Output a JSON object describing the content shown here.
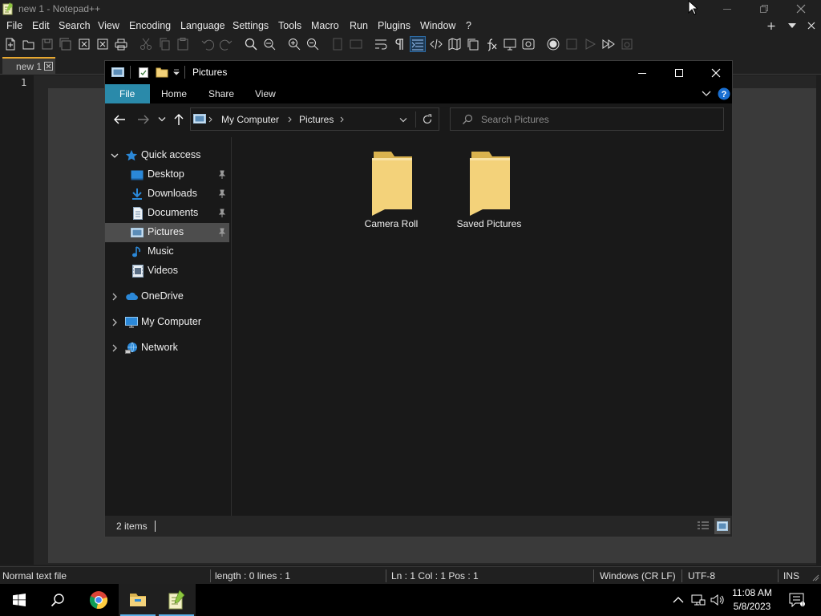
{
  "notepad": {
    "title": "new 1 - Notepad++",
    "menus": [
      "File",
      "Edit",
      "Search",
      "View",
      "Encoding",
      "Language",
      "Settings",
      "Tools",
      "Macro",
      "Run",
      "Plugins",
      "Window",
      "?"
    ],
    "tab_label": "new 1",
    "line_number": "1",
    "status": {
      "file_type": "Normal text file",
      "length_lines": "length : 0    lines : 1",
      "position": "Ln : 1    Col : 1    Pos : 1",
      "eol": "Windows (CR LF)",
      "encoding": "UTF-8",
      "mode": "INS"
    }
  },
  "explorer": {
    "title": "Pictures",
    "ribbon_tabs": [
      "File",
      "Home",
      "Share",
      "View"
    ],
    "address": [
      "My Computer",
      "Pictures"
    ],
    "search_placeholder": "Search Pictures",
    "nav": {
      "quick_access": "Quick access",
      "pinned": [
        "Desktop",
        "Downloads",
        "Documents",
        "Pictures"
      ],
      "unpinned": [
        "Music",
        "Videos"
      ],
      "onedrive": "OneDrive",
      "my_computer": "My Computer",
      "network": "Network",
      "selected": "Pictures"
    },
    "folders": [
      "Camera Roll",
      "Saved Pictures"
    ],
    "status": "2 items"
  },
  "taskbar": {
    "time": "11:08 AM",
    "date": "5/8/2023",
    "apps": [
      "chrome-icon",
      "file-explorer-icon",
      "notepadpp-icon"
    ]
  },
  "colors": {
    "accent": "#2a8aaa",
    "selection": "#4d4d4d",
    "folder": "#f3d27a"
  }
}
